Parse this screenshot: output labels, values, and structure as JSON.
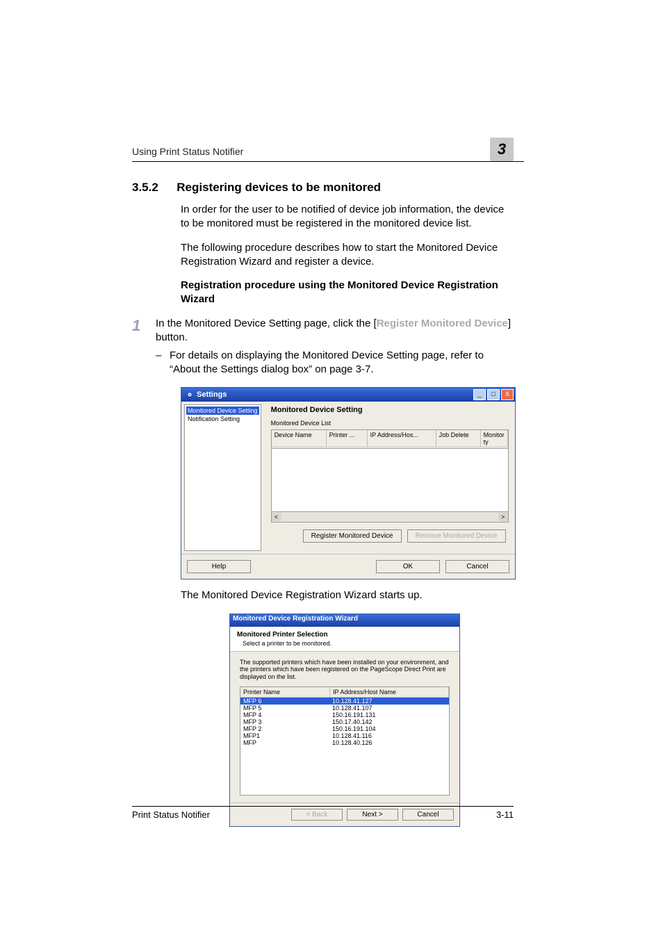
{
  "header": {
    "running": "Using Print Status Notifier",
    "chapter_digit": "3"
  },
  "section": {
    "number": "3.5.2",
    "title": "Registering devices to be monitored"
  },
  "body": {
    "p1": "In order for the user to be notified of device job information, the device to be monitored must be registered in the monitored device list.",
    "p2": "The following procedure describes how to start the Monitored Device Registration Wizard and register a device.",
    "subhead": "Registration procedure using the Monitored Device Registration Wizard",
    "step1_pre": "In the Monitored Device Setting page, click the [",
    "step1_em": "Register Monitored Device",
    "step1_post": "] button.",
    "step1_bullet": "For details on displaying the Monitored Device Setting page, refer to “About the Settings dialog box” on page 3-7.",
    "caption2": "The Monitored Device Registration Wizard starts up.",
    "step_num1": "1"
  },
  "settings_dialog": {
    "title": "Settings",
    "tree": {
      "item_selected": "Monitored Device Setting",
      "item2": "Notification Setting"
    },
    "main_heading": "Monitored Device Setting",
    "list_label": "Monitored Device List",
    "cols": {
      "c1": "Device Name",
      "c2": "Printer ...",
      "c3": "IP Address/Hos...",
      "c4": "Job Delete",
      "c5": "Monitor ty"
    },
    "scroll_left": "<",
    "scroll_right": ">",
    "btn_register": "Register Monitored Device",
    "btn_remove": "Remove Monitored Device",
    "btn_help": "Help",
    "btn_ok": "OK",
    "btn_cancel": "Cancel",
    "min": "_",
    "max": "□",
    "close": "X"
  },
  "wizard_dialog": {
    "title": "Monitored Device Registration Wizard",
    "h1": "Monitored Printer Selection",
    "h2": "Select a printer to be monitored.",
    "desc": "The supported printers which have been installed on your environment, and the printers which have been registered on the PageScope Direct Print are displayed on the list.",
    "col1": "Printer Name",
    "col2": "IP Address/Host Name",
    "rows": [
      {
        "name": "MFP 6",
        "ip": "10.128.41.127",
        "selected": true
      },
      {
        "name": "MFP 5",
        "ip": "10.128.41.107"
      },
      {
        "name": "MFP 4",
        "ip": "150.16.191.131"
      },
      {
        "name": "MFP 3",
        "ip": "150.17.40.142"
      },
      {
        "name": "MFP 2",
        "ip": "150.16.191.104"
      },
      {
        "name": "MFP1",
        "ip": "10.128.41.116"
      },
      {
        "name": "MFP",
        "ip": "10.128.40.126"
      }
    ],
    "btn_back": "< Back",
    "btn_next": "Next >",
    "btn_cancel": "Cancel"
  },
  "footer": {
    "left": "Print Status Notifier",
    "right": "3-11"
  }
}
